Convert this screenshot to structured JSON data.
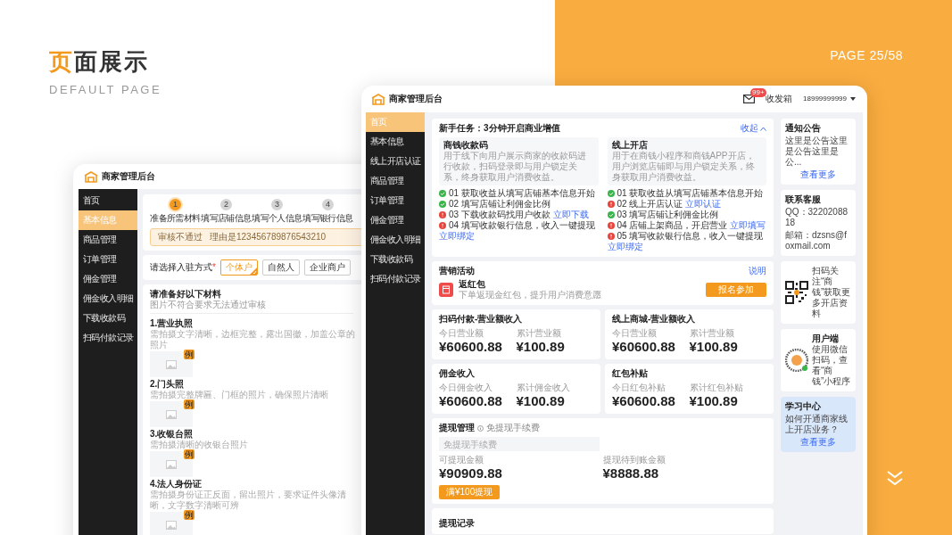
{
  "slide": {
    "title_accent": "页",
    "title_rest": "面展示",
    "subtitle": "DEFAULT PAGE",
    "page": "PAGE 25/58"
  },
  "back_window": {
    "brand": "商家管理后台",
    "nav": [
      {
        "label": "首页",
        "selected": false
      },
      {
        "label": "基本信息",
        "selected": true
      },
      {
        "label": "商品管理",
        "selected": false
      },
      {
        "label": "订单管理",
        "selected": false
      },
      {
        "label": "佣金管理",
        "selected": false
      },
      {
        "label": "佣金收入明细",
        "selected": false
      },
      {
        "label": "下载收款码",
        "selected": false
      },
      {
        "label": "扫码付款记录",
        "selected": false
      }
    ],
    "steps": [
      {
        "number": "1",
        "label": "准备所需材料",
        "selected": true
      },
      {
        "number": "2",
        "label": "填写店铺信息",
        "selected": false
      },
      {
        "number": "3",
        "label": "填写个人信息",
        "selected": false
      },
      {
        "number": "4",
        "label": "填写银行信息",
        "selected": false
      }
    ],
    "alert": {
      "status": "审核不通过",
      "reason": "理由是123456789876543210"
    },
    "entry": {
      "label": "请选择入驻方式",
      "required_mark": "*",
      "options": [
        {
          "label": "个体户",
          "selected": true
        },
        {
          "label": "自然人",
          "selected": false
        },
        {
          "label": "企业商户",
          "selected": false
        }
      ]
    },
    "materials": {
      "title": "请准备好以下材料",
      "note": "图片不符合要求无法通过审核",
      "items": [
        {
          "title": "1.营业执照",
          "hint": "需拍摄文字清晰，边框完整，露出国徽，加盖公章的照片",
          "badge": "例"
        },
        {
          "title": "2.门头照",
          "hint": "需拍摄完整牌匾、门框的照片，确保照片清晰",
          "badge": "例"
        },
        {
          "title": "3.收银台照",
          "hint": "需拍摄清晰的收银台照片",
          "badge": "例"
        },
        {
          "title": "4.法人身份证",
          "hint": "需拍摄身份证正反面，留出照片，要求证件头像清晰，文字数字清晰可辨",
          "badge": "例"
        }
      ]
    }
  },
  "front_window": {
    "brand": "商家管理后台",
    "inbox_badge": "99+",
    "inbox": "收发箱",
    "account": "18999999999",
    "nav": [
      {
        "label": "首页",
        "selected": true
      },
      {
        "label": "基本信息",
        "selected": false
      },
      {
        "label": "线上开店认证",
        "selected": false
      },
      {
        "label": "商品管理",
        "selected": false
      },
      {
        "label": "订单管理",
        "selected": false
      },
      {
        "label": "佣金管理",
        "selected": false
      },
      {
        "label": "佣金收入明细",
        "selected": false
      },
      {
        "label": "下载收款码",
        "selected": false
      },
      {
        "label": "扫码付款记录",
        "selected": false
      }
    ],
    "tasks": {
      "title": "新手任务：3分钟开启商业增值",
      "toggle": "收起",
      "groups": [
        {
          "title": "商钱收款码",
          "description": "用于线下向用户展示商家的收款码进行收款，扫码登录即与用户锁定关系，终身获取用户消费收益。",
          "items": [
            {
              "text": "01 获取收益从填写店铺基本信息开始",
              "done": true
            },
            {
              "text": "02 填写店铺让利佣金比例",
              "done": true
            },
            {
              "text": "03 下载收款码找用户收款",
              "done": false,
              "link": "立即下载"
            },
            {
              "text": "04 填写收款银行信息，收入一键提现",
              "done": false,
              "link": "立即绑定"
            }
          ]
        },
        {
          "title": "线上开店",
          "description": "用于在商钱小程序和商钱APP开店，用户浏览店铺即与用户锁定关系，终身获取用户消费收益。",
          "items": [
            {
              "text": "01 获取收益从填写店铺基本信息开始",
              "done": true
            },
            {
              "text": "02 线上开店认证",
              "done": false,
              "link": "立即认证"
            },
            {
              "text": "03 填写店铺让利佣金比例",
              "done": true
            },
            {
              "text": "04 店铺上架商品，开启营业",
              "done": false,
              "link": "立即填写"
            },
            {
              "text": "05 填写收款银行信息，收入一键提现",
              "done": false,
              "link": "立即绑定"
            }
          ]
        }
      ]
    },
    "marketing": {
      "title": "营销活动",
      "link": "说明",
      "promo": {
        "name": "返红包",
        "description": "下单返现金红包，提升用户消费意愿"
      },
      "button": "报名参加"
    },
    "income_cards": [
      {
        "title": "扫码付款-营业额收入",
        "stats": [
          {
            "label": "今日营业额",
            "value": "¥60600.88"
          },
          {
            "label": "累计营业额",
            "value": "¥100.89"
          }
        ]
      },
      {
        "title": "线上商城-营业额收入",
        "stats": [
          {
            "label": "今日营业额",
            "value": "¥60600.88"
          },
          {
            "label": "累计营业额",
            "value": "¥100.89"
          }
        ]
      },
      {
        "title": "佣金收入",
        "stats": [
          {
            "label": "今日佣金收入",
            "value": "¥60600.88"
          },
          {
            "label": "累计佣金收入",
            "value": "¥100.89"
          }
        ]
      },
      {
        "title": "红包补贴",
        "stats": [
          {
            "label": "今日红包补贴",
            "value": "¥60600.88"
          },
          {
            "label": "累计红包补贴",
            "value": "¥100.89"
          }
        ]
      }
    ],
    "withdraw": {
      "title": "提现管理",
      "hint": "免提现手续费",
      "placeholder": "免提现手续费",
      "stats": [
        {
          "label": "可提现金额",
          "value": "¥90909.88"
        },
        {
          "label": "提现待到账金额",
          "value": "¥8888.88"
        }
      ],
      "button": "满¥100提现"
    },
    "records": {
      "title": "提现记录"
    },
    "notice": {
      "title": "通知公告",
      "text": "这里是公告这里是公告这里是公...",
      "link": "查看更多"
    },
    "contact": {
      "title": "联系客服",
      "qq": "QQ：3220208818",
      "email": "邮箱：dzsns@foxmail.com"
    },
    "qr": {
      "text": "扫码关注“商钱”获取更多开店资料"
    },
    "user_app": {
      "title": "用户端",
      "text": "使用微信扫码，查看“商钱”小程序"
    },
    "learning": {
      "title": "学习中心",
      "text": "如何开通商家线上开店业务？",
      "link": "查看更多"
    }
  }
}
